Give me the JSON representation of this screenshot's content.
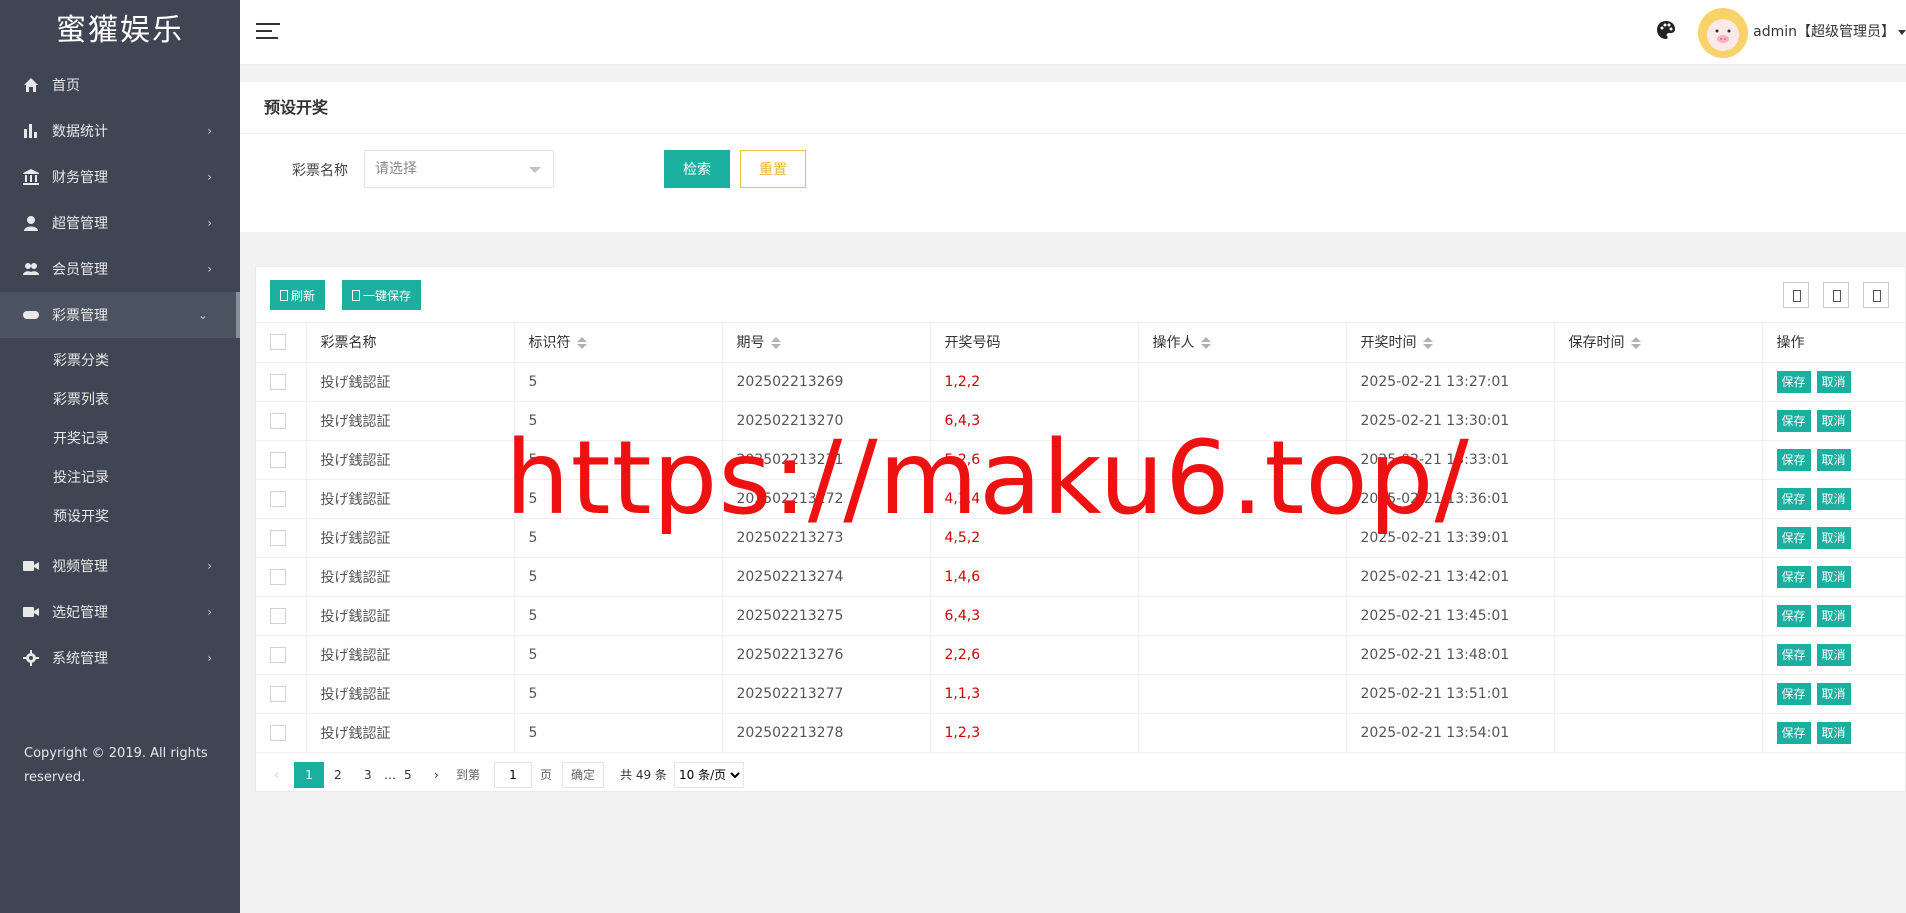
{
  "sidebar": {
    "logo": "蜜獾娱乐",
    "items": [
      {
        "label": "首页"
      },
      {
        "label": "数据统计"
      },
      {
        "label": "财务管理"
      },
      {
        "label": "超管管理"
      },
      {
        "label": "会员管理"
      },
      {
        "label": "彩票管理"
      },
      {
        "label": "视频管理"
      },
      {
        "label": "选妃管理"
      },
      {
        "label": "系统管理"
      }
    ],
    "lottery_sub": [
      "彩票分类",
      "彩票列表",
      "开奖记录",
      "投注记录",
      "预设开奖"
    ],
    "copyright": "Copyright © 2019. All rights reserved."
  },
  "header": {
    "user": "admin【超级管理员】"
  },
  "search": {
    "title": "预设开奖",
    "label": "彩票名称",
    "placeholder": "请选择",
    "search_btn": "检索",
    "reset_btn": "重置"
  },
  "toolbar": {
    "refresh": "刷新",
    "save_all": "一键保存"
  },
  "table": {
    "columns": [
      "彩票名称",
      "标识符",
      "期号",
      "开奖号码",
      "操作人",
      "开奖时间",
      "保存时间",
      "操作"
    ],
    "rows": [
      {
        "name": "投げ銭認証",
        "code": "5",
        "issue": "202502213269",
        "numbers": "1,2,2",
        "operator": "",
        "time": "2025-02-21 13:27:01",
        "saved": ""
      },
      {
        "name": "投げ銭認証",
        "code": "5",
        "issue": "202502213270",
        "numbers": "6,4,3",
        "operator": "",
        "time": "2025-02-21 13:30:01",
        "saved": ""
      },
      {
        "name": "投げ銭認証",
        "code": "5",
        "issue": "202502213271",
        "numbers": "5,2,6",
        "operator": "",
        "time": "2025-02-21 13:33:01",
        "saved": ""
      },
      {
        "name": "投げ銭認証",
        "code": "5",
        "issue": "202502213272",
        "numbers": "4,1,4",
        "operator": "",
        "time": "2025-02-21 13:36:01",
        "saved": ""
      },
      {
        "name": "投げ銭認証",
        "code": "5",
        "issue": "202502213273",
        "numbers": "4,5,2",
        "operator": "",
        "time": "2025-02-21 13:39:01",
        "saved": ""
      },
      {
        "name": "投げ銭認証",
        "code": "5",
        "issue": "202502213274",
        "numbers": "1,4,6",
        "operator": "",
        "time": "2025-02-21 13:42:01",
        "saved": ""
      },
      {
        "name": "投げ銭認証",
        "code": "5",
        "issue": "202502213275",
        "numbers": "6,4,3",
        "operator": "",
        "time": "2025-02-21 13:45:01",
        "saved": ""
      },
      {
        "name": "投げ銭認証",
        "code": "5",
        "issue": "202502213276",
        "numbers": "2,2,6",
        "operator": "",
        "time": "2025-02-21 13:48:01",
        "saved": ""
      },
      {
        "name": "投げ銭認証",
        "code": "5",
        "issue": "202502213277",
        "numbers": "1,1,3",
        "operator": "",
        "time": "2025-02-21 13:51:01",
        "saved": ""
      },
      {
        "name": "投げ銭認証",
        "code": "5",
        "issue": "202502213278",
        "numbers": "1,2,3",
        "operator": "",
        "time": "2025-02-21 13:54:01",
        "saved": ""
      }
    ],
    "save_btn": "保存",
    "cancel_btn": "取消"
  },
  "pager": {
    "pages": [
      "1",
      "2",
      "3",
      "…",
      "5"
    ],
    "goto_label": "到第",
    "goto_value": "1",
    "page_unit": "页",
    "confirm": "确定",
    "total": "共 49 条",
    "size_option": "10 条/页"
  },
  "watermark": "https://maku6.top/",
  "colors": {
    "sidebar_bg": "#3f4553",
    "accent": "#1aaf9f",
    "reset": "#e8b631",
    "number": "#cc0000",
    "watermark": "#ee1111"
  }
}
